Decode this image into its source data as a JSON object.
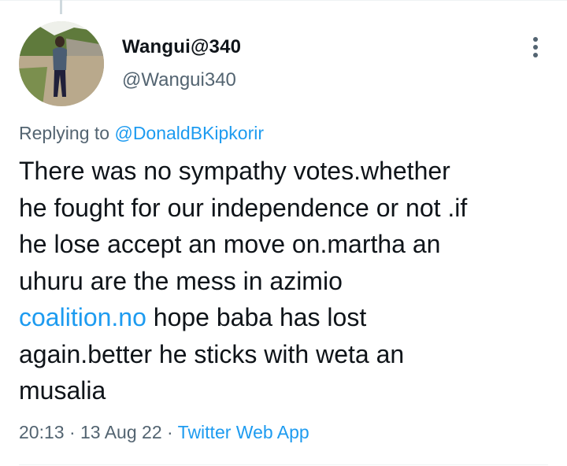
{
  "tweet": {
    "author": {
      "display_name": "Wangui@340",
      "handle": "@Wangui340",
      "avatar_icon": "user-photo"
    },
    "more_icon": "vertical-ellipsis-icon",
    "replying_to": {
      "prefix": "Replying to",
      "mention": "@DonaldBKipkorir"
    },
    "text": {
      "line1": "There was no sympathy votes.whether",
      "line2": "he fought for our independence or not .if",
      "line3": "he lose accept an move on.martha an",
      "line4": "uhuru are the mess in azimio",
      "link": "coalition.no",
      "line5_rest": "hope baba has lost",
      "line6": "again.better he sticks with weta an",
      "line7": "musalia"
    },
    "meta": {
      "time": "20:13",
      "date": "13 Aug 22",
      "separator": "·",
      "app": "Twitter Web App"
    }
  },
  "colors": {
    "accent": "#1d9bf0",
    "secondary_text": "#536471",
    "primary_text": "#0f1419",
    "divider": "#eff3f4"
  }
}
